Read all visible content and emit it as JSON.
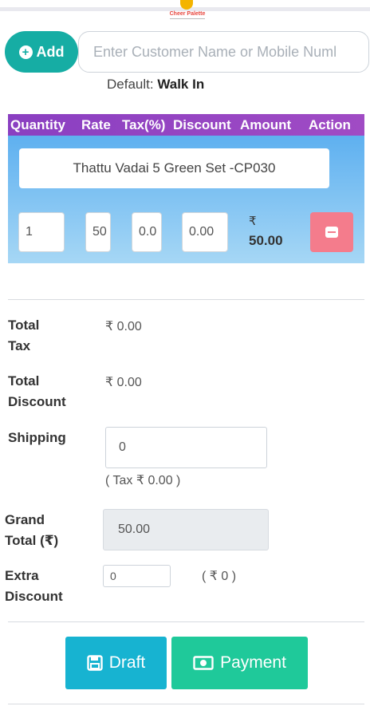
{
  "brand": {
    "logo_text": "Cheer Palette"
  },
  "customer": {
    "add_label": "Add",
    "search_placeholder": "Enter Customer Name or Mobile Numl",
    "default_prefix": "Default:",
    "default_value": "Walk In"
  },
  "table": {
    "headers": [
      "Quantity",
      "Rate",
      "Tax(%)",
      "Discount",
      "Amount",
      "Action"
    ],
    "rows": [
      {
        "product": "Thattu Vadai 5 Green Set -CP030",
        "quantity": "1",
        "rate": "50",
        "tax": "0.0",
        "discount": "0.00",
        "amount_currency": "₹",
        "amount_value": "50.00"
      }
    ]
  },
  "summary": {
    "total_tax_label": "Total Tax",
    "total_tax_value": "₹ 0.00",
    "total_discount_label": "Total Discount",
    "total_discount_value": "₹ 0.00",
    "shipping_label": "Shipping",
    "shipping_value": "0",
    "shipping_tax_note": "( Tax ₹ 0.00 )",
    "grand_total_label": "Grand Total (₹)",
    "grand_total_value": "50.00",
    "extra_discount_label": "Extra Discount",
    "extra_discount_value": "0",
    "extra_discount_note": "( ₹ 0 )"
  },
  "actions": {
    "draft_label": "Draft",
    "payment_label": "Payment"
  },
  "colors": {
    "accent": "#16ada4",
    "header_purple": "#8a3fc1",
    "remove_red": "#f47c8c",
    "draft_blue": "#17b3d1",
    "payment_green": "#1fc99a"
  }
}
